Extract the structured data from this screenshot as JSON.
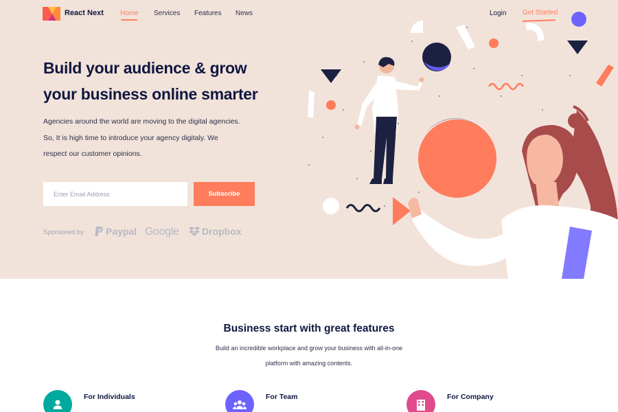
{
  "nav": {
    "brand": "React Next",
    "links": [
      "Home",
      "Services",
      "Features",
      "News"
    ],
    "login": "Login",
    "get_started": "Get Started"
  },
  "hero": {
    "headline_line1": "Build your audience & grow",
    "headline_line2": "your business online smarter",
    "desc_line1": "Agencies around the world are moving to the digital agencies.",
    "desc_line2": "So, It is high time to introduce your agency digitaly. We",
    "desc_line3": "respect our customer opinions.",
    "email_placeholder": "Enter Email Address",
    "subscribe_label": "Subscribe",
    "sponsored_label": "Sponsored by:",
    "sponsors": [
      "Paypal",
      "Google",
      "Dropbox"
    ]
  },
  "features": {
    "title": "Business start with great features",
    "sub_line1": "Build an incredible workplace and grow your business with all-in-one",
    "sub_line2": "platform with amazing contents.",
    "items": [
      {
        "label": "For Individuals",
        "icon": "user-icon",
        "color": "#00a99d"
      },
      {
        "label": "For Team",
        "icon": "team-icon",
        "color": "#6c63ff"
      },
      {
        "label": "For Company",
        "icon": "building-icon",
        "color": "#e04a8c"
      }
    ]
  },
  "colors": {
    "accent": "#ff7c5c",
    "hero_bg": "#f2e3da",
    "navy": "#0f1740",
    "purple": "#6c63ff"
  }
}
